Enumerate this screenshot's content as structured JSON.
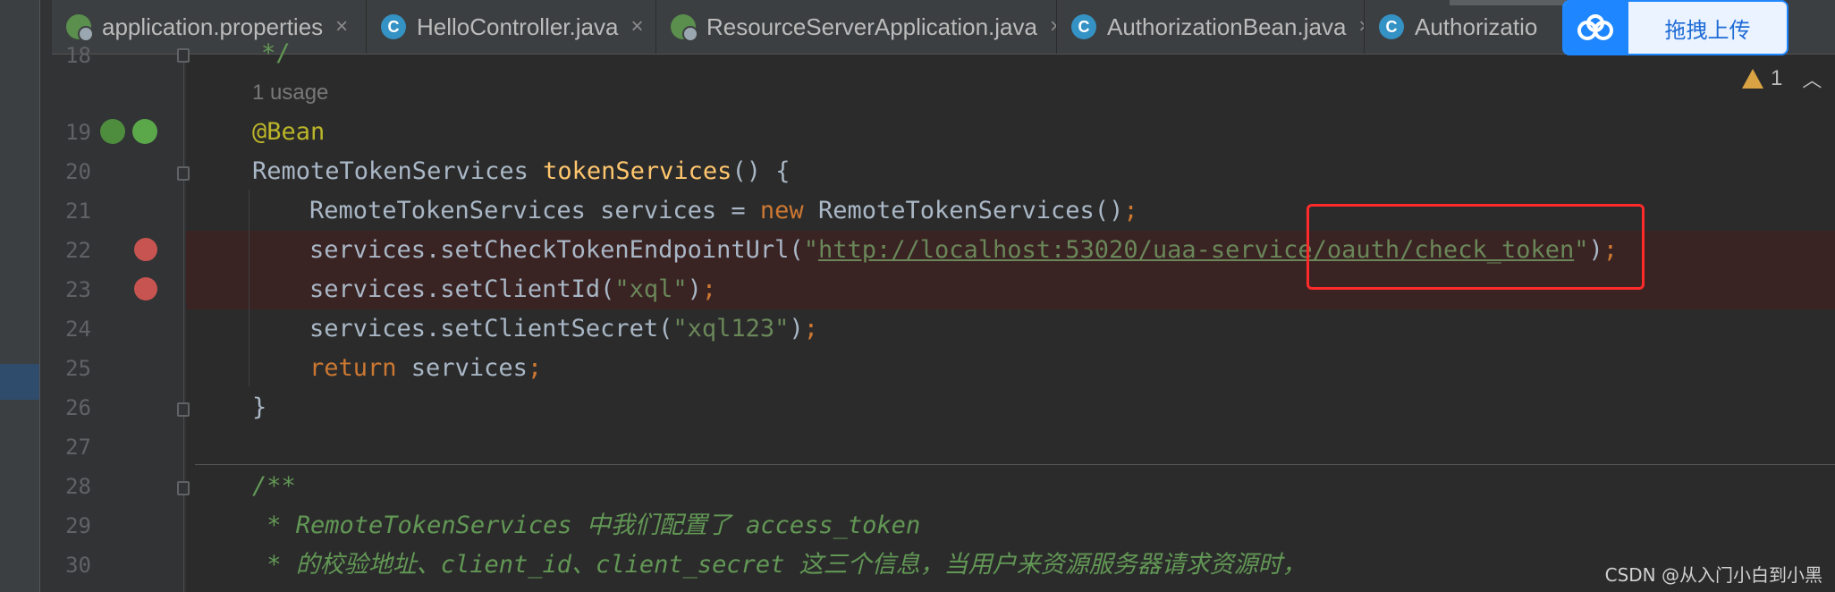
{
  "tabs": [
    {
      "label": "application.properties",
      "icon": "properties-gear-icon"
    },
    {
      "label": "HelloController.java",
      "icon": "java-class-icon"
    },
    {
      "label": "ResourceServerApplication.java",
      "icon": "spring-app-icon"
    },
    {
      "label": "AuthorizationBean.java",
      "icon": "java-class-icon"
    },
    {
      "label": "Authorizatio",
      "icon": "java-class-icon"
    }
  ],
  "upload": {
    "label": "拖拽上传"
  },
  "inspection": {
    "count": "1"
  },
  "editor": {
    "usage_hint": "1 usage",
    "line_numbers": [
      "18",
      "19",
      "20",
      "21",
      "22",
      "23",
      "24",
      "25",
      "26",
      "27",
      "28",
      "29",
      "30"
    ],
    "lines": {
      "l18": "*/",
      "l19_annotation": "@Bean",
      "l20_type": "RemoteTokenServices ",
      "l20_method": "tokenServices",
      "l20_rest": "() {",
      "l21_a": "RemoteTokenServices services = ",
      "l21_new": "new",
      "l21_b": " RemoteTokenServices()",
      "l21_semi": ";",
      "l22_a": "services.setCheckTokenEndpointUrl(",
      "l22_q1": "\"",
      "l22_url": "http://localhost:53020/uaa-service/oauth/check_token",
      "l22_q2": "\"",
      "l22_b": ")",
      "l22_semi": ";",
      "l23_a": "services.setClientId(",
      "l23_str": "\"xql\"",
      "l23_b": ")",
      "l23_semi": ";",
      "l24_a": "services.setClientSecret(",
      "l24_str": "\"xql123\"",
      "l24_b": ")",
      "l24_semi": ";",
      "l25_kw": "return",
      "l25_a": " services",
      "l25_semi": ";",
      "l26": "}",
      "l28": "/**",
      "l29": " * RemoteTokenServices 中我们配置了 access_token",
      "l30": " * 的校验地址、client_id、client_secret 这三个信息，当用户来资源服务器请求资源时，"
    }
  },
  "watermark": "CSDN @从入门小白到小黑",
  "colors": {
    "background": "#2b2b2b",
    "keyword": "#cc7832",
    "string": "#6a8759",
    "method": "#ffc66d",
    "annotation": "#bbb529",
    "breakpoint": "#c75450",
    "highlight_box": "#ff2b2b"
  }
}
